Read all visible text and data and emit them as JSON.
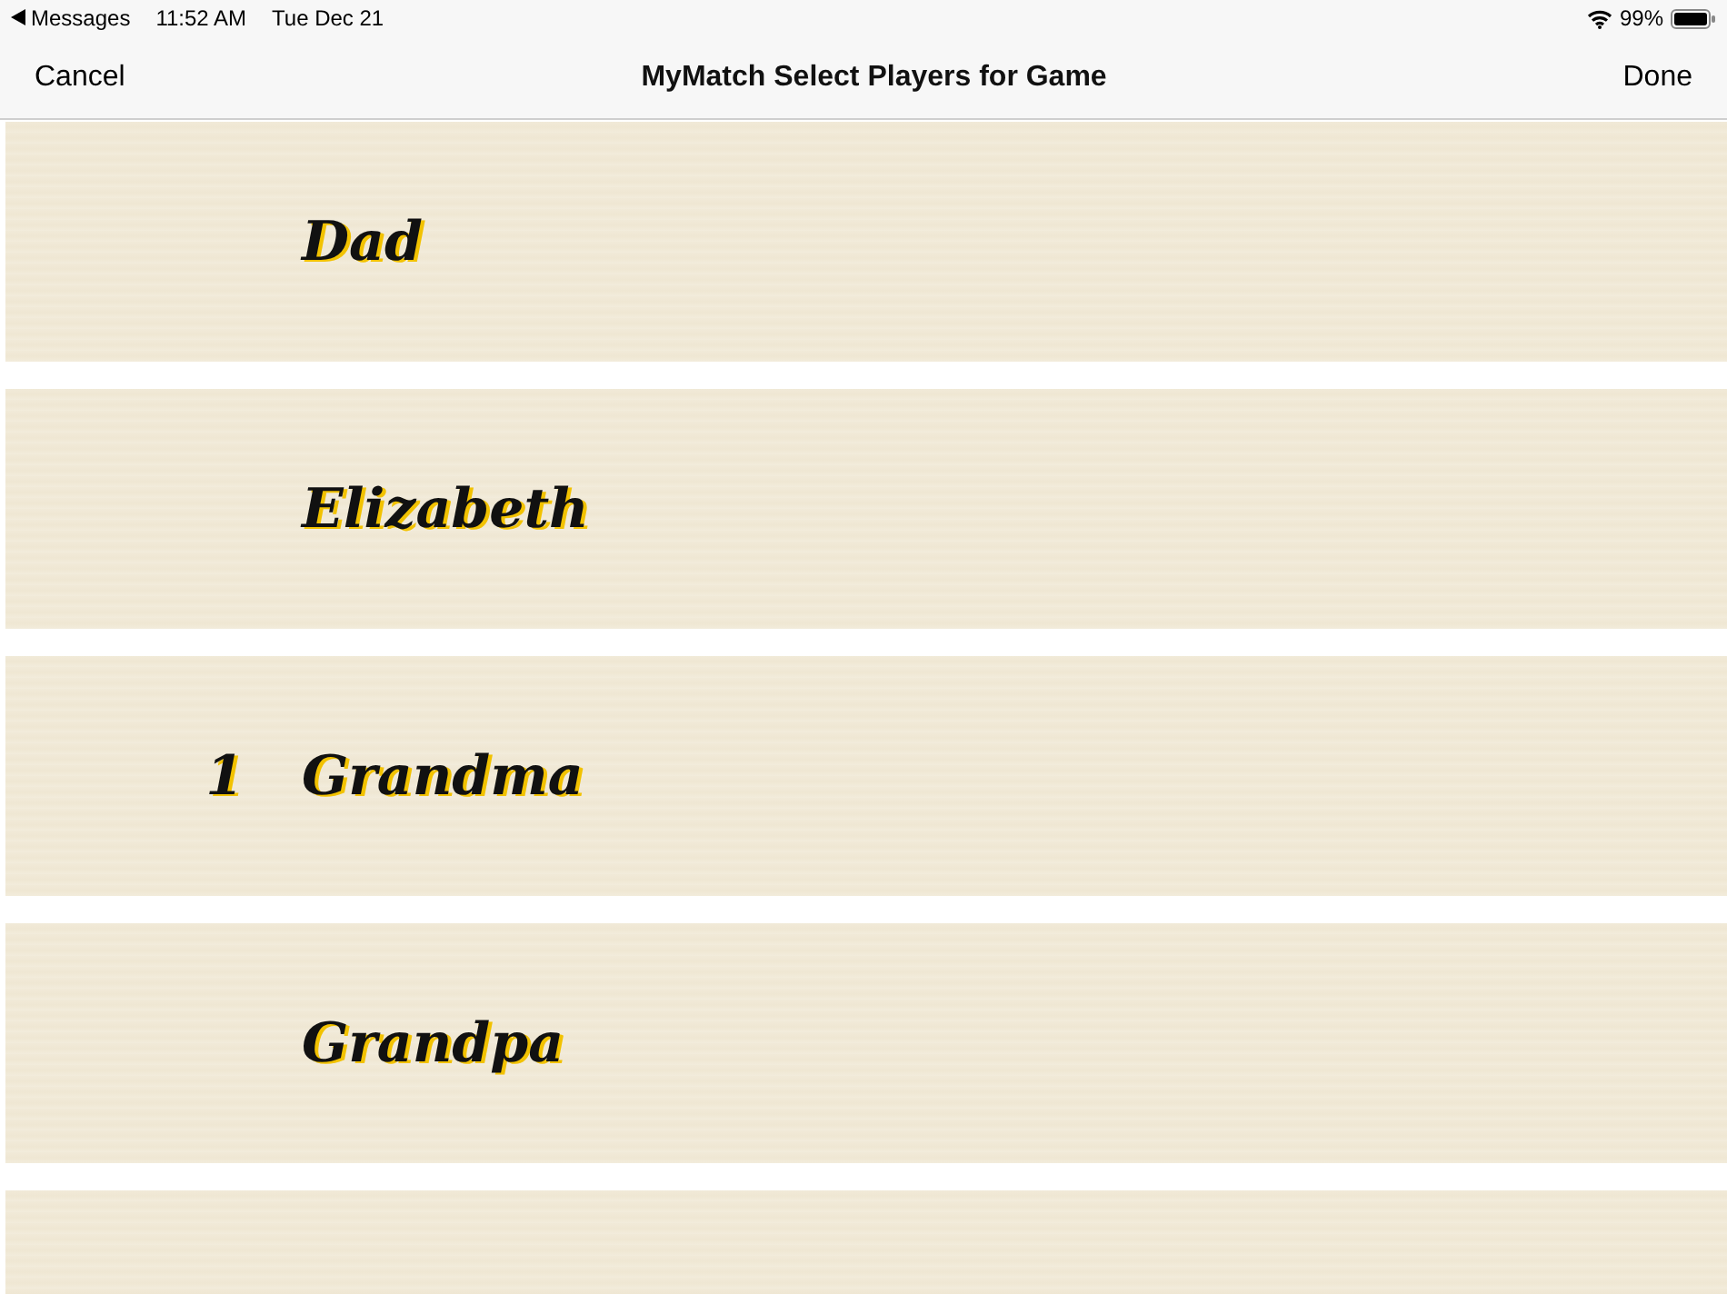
{
  "status_bar": {
    "back_app": "Messages",
    "time": "11:52 AM",
    "date": "Tue Dec 21",
    "battery": "99%"
  },
  "nav": {
    "left": "Cancel",
    "title": "MyMatch Select Players for Game",
    "right": "Done"
  },
  "players": [
    {
      "name": "Dad"
    },
    {
      "name": "Elizabeth"
    },
    {
      "name": "Grandma",
      "number": "1"
    },
    {
      "name": "Grandpa"
    }
  ]
}
